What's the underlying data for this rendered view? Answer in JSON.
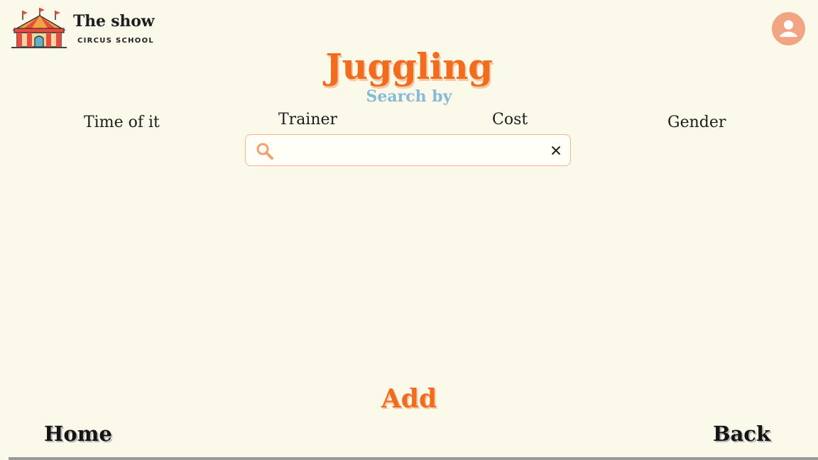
{
  "header": {
    "brand_title": "The show",
    "brand_subtitle": "CIRCUS SCHOOL",
    "logo_icon": "circus-tent-icon",
    "avatar_icon": "user-avatar-icon"
  },
  "main": {
    "title": "Juggling",
    "search_by_label": "Search by",
    "filters": [
      {
        "label": "Time of it"
      },
      {
        "label": "Trainer"
      },
      {
        "label": "Cost"
      },
      {
        "label": "Gender"
      }
    ],
    "search": {
      "value": "",
      "placeholder": ""
    },
    "add_label": "Add"
  },
  "footer": {
    "home_label": "Home",
    "back_label": "Back"
  },
  "colors": {
    "background": "#fbfaea",
    "accent_orange": "#f26c1f",
    "search_by_blue": "#86bad6",
    "avatar_peach": "#f2a583"
  }
}
